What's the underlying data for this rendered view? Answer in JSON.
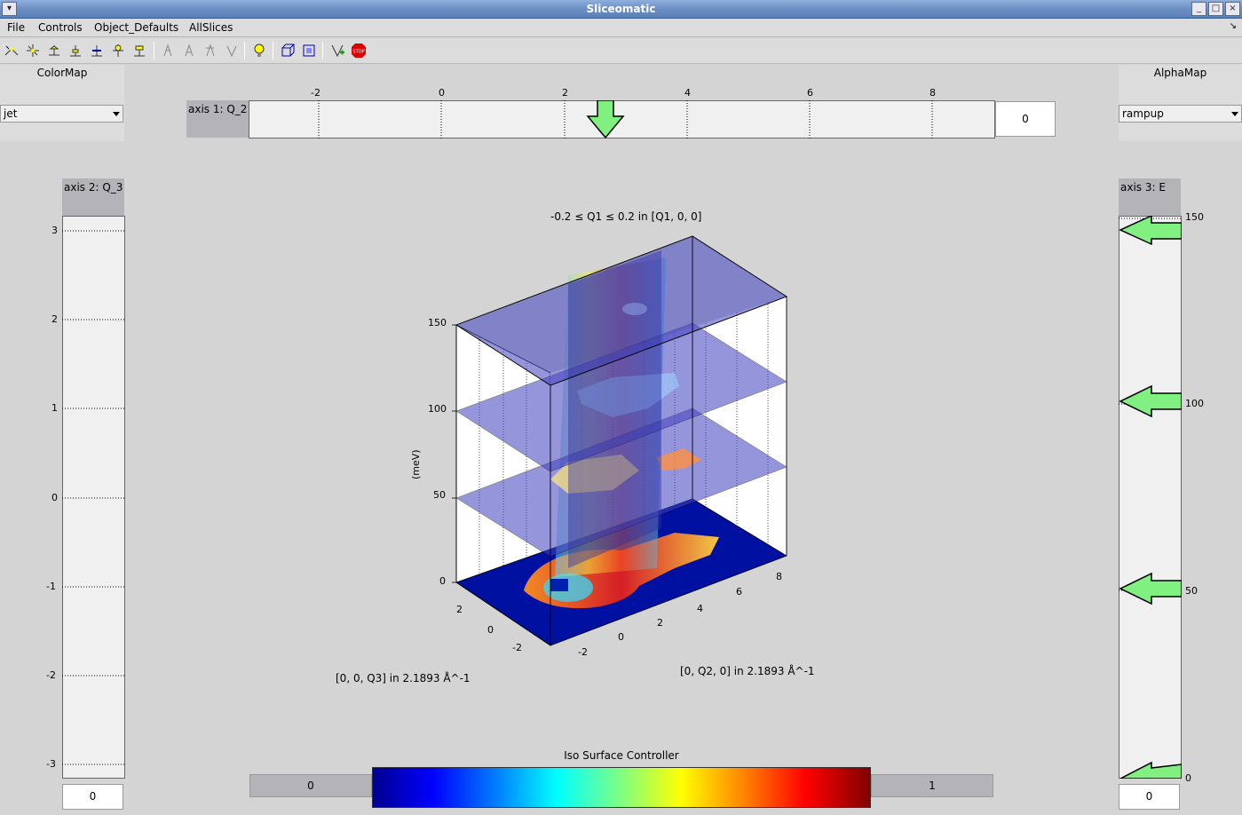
{
  "window": {
    "title": "Sliceomatic"
  },
  "menu": [
    "File",
    "Controls",
    "Object_Defaults",
    "AllSlices"
  ],
  "toolbar": {
    "icons": [
      "xyz-slice-icon",
      "xyz-slice-icon-2",
      "x-slice-icon",
      "y-slice-icon",
      "z-slice-icon",
      "iso-icon",
      "slice-tool-icon",
      "slice-tool-icon-2",
      "slice-tool-icon-3",
      "slice-tool-icon-4",
      "light-bulb-icon",
      "box-view-icon",
      "box-view-2-icon",
      "add-icon",
      "stop-icon"
    ]
  },
  "left_panel": {
    "label": "ColorMap",
    "selected": "jet"
  },
  "right_panel": {
    "label": "AlphaMap",
    "selected": "rampup"
  },
  "axis1": {
    "label": "axis 1: Q_2",
    "value": "0",
    "ticks": [
      "-2",
      "0",
      "2",
      "4",
      "6",
      "8"
    ]
  },
  "axis2": {
    "label": "axis 2: Q_3",
    "value": "0",
    "ticks": [
      "3",
      "2",
      "1",
      "0",
      "-1",
      "-2",
      "-3"
    ]
  },
  "axis3": {
    "label": "axis 3: E",
    "value": "0",
    "ticks": [
      "150",
      "100",
      "50",
      "0"
    ]
  },
  "plot": {
    "title": "-0.2 ≤ Q1 ≤ 0.2 in [Q1, 0, 0]",
    "zlabel": "(meV)",
    "z_ticks": [
      "150",
      "100",
      "50",
      "0"
    ],
    "x_ticks": [
      "8",
      "6",
      "4",
      "2",
      "0",
      "-2"
    ],
    "y_ticks": [
      "2",
      "0",
      "-2"
    ],
    "xlabel": "[0, Q2, 0] in 2.1893 Å^-1",
    "ylabel": "[0, 0, Q3] in 2.1893 Å^-1"
  },
  "iso": {
    "label": "Iso Surface Controller",
    "min": "0",
    "max": "1"
  },
  "colors": {
    "accent": "#6b8fc4",
    "arrow": "#80f080"
  }
}
